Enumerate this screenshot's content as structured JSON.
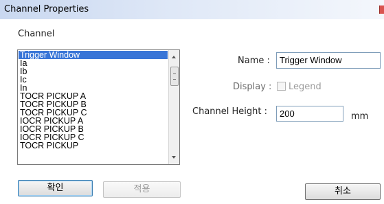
{
  "window": {
    "title": "Channel Properties"
  },
  "group": {
    "label": "Channel"
  },
  "channels": {
    "items": [
      "Trigger Window",
      "Ia",
      "Ib",
      "Ic",
      "In",
      "TOCR PICKUP A",
      "TOCR PICKUP B",
      "TOCR PICKUP C",
      "IOCR PICKUP A",
      "IOCR PICKUP B",
      "IOCR PICKUP C",
      "TOCR PICKUP"
    ],
    "selected_index": 0
  },
  "form": {
    "name_label": "Name :",
    "name_value": "Trigger Window",
    "display_label": "Display :",
    "legend_label": "Legend",
    "legend_checked": false,
    "height_label": "Channel Height :",
    "height_value": "200",
    "height_unit": "mm"
  },
  "buttons": {
    "ok": "확인",
    "apply": "적용",
    "cancel": "취소"
  }
}
